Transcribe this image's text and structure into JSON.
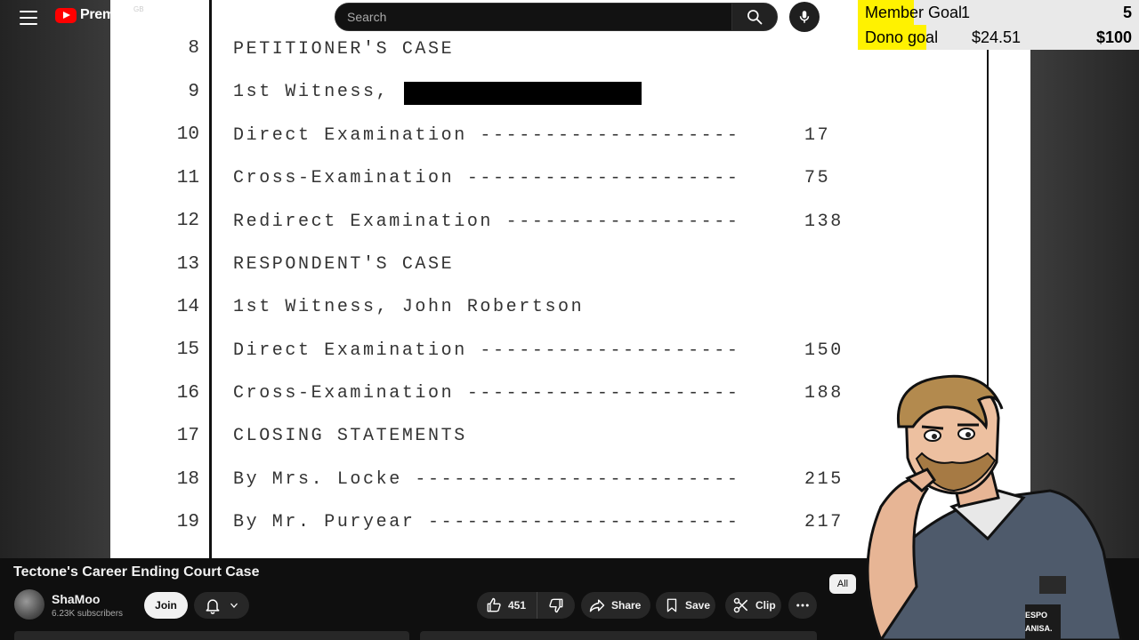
{
  "header": {
    "logo_text": "Premium",
    "region": "GB",
    "search_placeholder": "Search"
  },
  "goals": {
    "member": {
      "label": "Member Goal",
      "current": "1",
      "target": "5",
      "progress": 0.2
    },
    "dono": {
      "label": "Dono goal",
      "current": "$24.51",
      "target": "$100",
      "progress": 0.245
    }
  },
  "document": {
    "lines": [
      {
        "num": "8",
        "text": "PETITIONER'S CASE",
        "page": ""
      },
      {
        "num": "9",
        "text": "1st Witness,",
        "page": ""
      },
      {
        "num": "10",
        "text": "Direct Examination --------------------",
        "page": "17"
      },
      {
        "num": "11",
        "text": "Cross-Examination ---------------------",
        "page": "75"
      },
      {
        "num": "12",
        "text": "Redirect Examination ------------------",
        "page": "138"
      },
      {
        "num": "13",
        "text": "RESPONDENT'S CASE",
        "page": ""
      },
      {
        "num": "14",
        "text": "1st Witness, John Robertson",
        "page": ""
      },
      {
        "num": "15",
        "text": "Direct Examination --------------------",
        "page": "150"
      },
      {
        "num": "16",
        "text": "Cross-Examination ---------------------",
        "page": "188"
      },
      {
        "num": "17",
        "text": "CLOSING STATEMENTS",
        "page": ""
      },
      {
        "num": "18",
        "text": "By Mrs. Locke -------------------------",
        "page": "215"
      },
      {
        "num": "19",
        "text": "By Mr. Puryear ------------------------",
        "page": "217"
      }
    ]
  },
  "video": {
    "title": "Tectone's Career Ending Court Case",
    "channel": "ShaMoo",
    "subscribers": "6.23K subscribers",
    "join_label": "Join",
    "likes": "451",
    "share_label": "Share",
    "save_label": "Save",
    "clip_label": "Clip"
  },
  "sidebar": {
    "chip_all": "All",
    "thumb_text_1": "ESPO",
    "thumb_text_2": "ANISA."
  },
  "colors": {
    "youtube_red": "#ff0000",
    "goal_highlight": "#fff200",
    "page_bg": "#0f0f0f"
  }
}
